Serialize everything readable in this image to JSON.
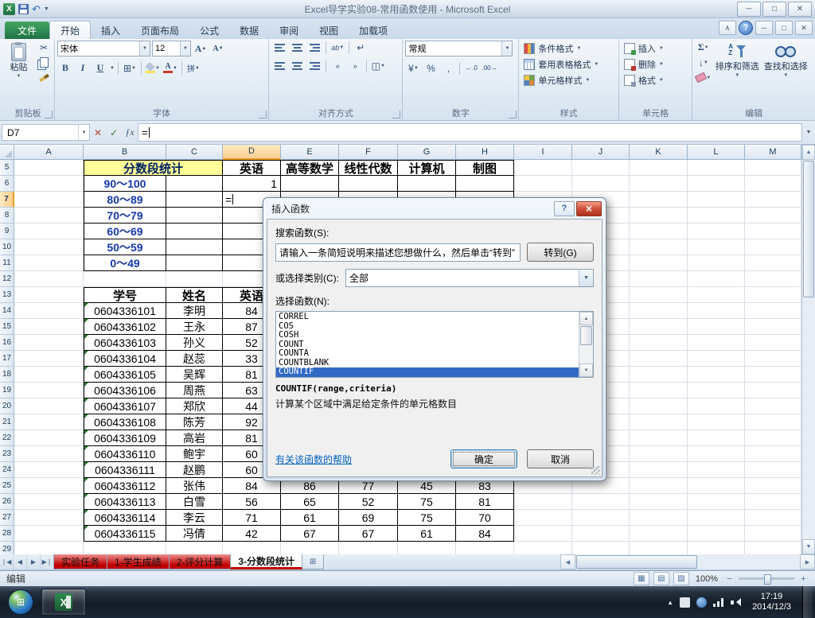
{
  "window": {
    "title": "Excel导学实验08-常用函数使用  -  Microsoft Excel"
  },
  "ribbon": {
    "file_tab": "文件",
    "tabs": [
      "开始",
      "插入",
      "页面布局",
      "公式",
      "数据",
      "审阅",
      "视图",
      "加载项"
    ],
    "active_tab": "开始",
    "groups": {
      "clipboard": {
        "label": "剪贴板",
        "paste": "粘贴"
      },
      "font": {
        "label": "字体",
        "font_name": "宋体",
        "font_size": "12"
      },
      "alignment": {
        "label": "对齐方式"
      },
      "number": {
        "label": "数字",
        "format": "常规"
      },
      "styles": {
        "label": "样式",
        "items": [
          "条件格式",
          "套用表格格式",
          "单元格样式"
        ]
      },
      "cells": {
        "label": "单元格",
        "items": [
          "插入",
          "删除",
          "格式"
        ]
      },
      "editing": {
        "label": "编辑",
        "sort": "排序和筛选",
        "find": "查找和选择"
      }
    }
  },
  "formula_bar": {
    "name_box": "D7",
    "formula": "="
  },
  "grid": {
    "columns": [
      "A",
      "B",
      "C",
      "D",
      "E",
      "F",
      "G",
      "H",
      "I",
      "J",
      "K",
      "L",
      "M"
    ],
    "selected_column": "D",
    "selected_row": 7,
    "bordered_ranges": [
      {
        "rows": [
          5,
          11
        ],
        "cols": [
          "B",
          "H"
        ]
      },
      {
        "rows": [
          13,
          28
        ],
        "cols": [
          "B",
          "H"
        ]
      }
    ],
    "rows": [
      {
        "n": 5,
        "cells": [
          [
            "B",
            "分数段统计",
            "ttl",
            2
          ],
          [
            "D",
            "英语",
            "hdr"
          ],
          [
            "E",
            "高等数学",
            "hdr"
          ],
          [
            "F",
            "线性代数",
            "hdr"
          ],
          [
            "G",
            "计算机",
            "hdr"
          ],
          [
            "H",
            "制图",
            "hdr"
          ]
        ]
      },
      {
        "n": 6,
        "cells": [
          [
            "B",
            "90～100",
            "rng"
          ],
          [
            "D",
            "1",
            "numr"
          ]
        ]
      },
      {
        "n": 7,
        "cells": [
          [
            "B",
            "80～89",
            "rng"
          ],
          [
            "D",
            "=",
            "edit"
          ]
        ]
      },
      {
        "n": 8,
        "cells": [
          [
            "B",
            "70～79",
            "rng"
          ]
        ]
      },
      {
        "n": 9,
        "cells": [
          [
            "B",
            "60～69",
            "rng"
          ]
        ]
      },
      {
        "n": 10,
        "cells": [
          [
            "B",
            "50～59",
            "rng"
          ]
        ]
      },
      {
        "n": 11,
        "cells": [
          [
            "B",
            "0～49",
            "rng"
          ]
        ]
      },
      {
        "n": 12,
        "cells": []
      },
      {
        "n": 13,
        "cells": [
          [
            "B",
            "学号",
            "hdr"
          ],
          [
            "C",
            "姓名",
            "hdr"
          ],
          [
            "D",
            "英语",
            "hdr"
          ]
        ]
      },
      {
        "n": 14,
        "cells": [
          [
            "B",
            "0604336101",
            "id"
          ],
          [
            "C",
            "李明",
            "nm"
          ],
          [
            "D",
            "84",
            "sc"
          ]
        ]
      },
      {
        "n": 15,
        "cells": [
          [
            "B",
            "0604336102",
            "id"
          ],
          [
            "C",
            "王永",
            "nm"
          ],
          [
            "D",
            "87",
            "sc"
          ]
        ]
      },
      {
        "n": 16,
        "cells": [
          [
            "B",
            "0604336103",
            "id"
          ],
          [
            "C",
            "孙义",
            "nm"
          ],
          [
            "D",
            "52",
            "sc"
          ]
        ]
      },
      {
        "n": 17,
        "cells": [
          [
            "B",
            "0604336104",
            "id"
          ],
          [
            "C",
            "赵蕊",
            "nm"
          ],
          [
            "D",
            "33",
            "sc"
          ]
        ]
      },
      {
        "n": 18,
        "cells": [
          [
            "B",
            "0604336105",
            "id"
          ],
          [
            "C",
            "吴辉",
            "nm"
          ],
          [
            "D",
            "81",
            "sc"
          ]
        ]
      },
      {
        "n": 19,
        "cells": [
          [
            "B",
            "0604336106",
            "id"
          ],
          [
            "C",
            "周燕",
            "nm"
          ],
          [
            "D",
            "63",
            "sc"
          ]
        ]
      },
      {
        "n": 20,
        "cells": [
          [
            "B",
            "0604336107",
            "id"
          ],
          [
            "C",
            "郑欣",
            "nm"
          ],
          [
            "D",
            "44",
            "sc"
          ]
        ]
      },
      {
        "n": 21,
        "cells": [
          [
            "B",
            "0604336108",
            "id"
          ],
          [
            "C",
            "陈芳",
            "nm"
          ],
          [
            "D",
            "92",
            "sc"
          ]
        ]
      },
      {
        "n": 22,
        "cells": [
          [
            "B",
            "0604336109",
            "id"
          ],
          [
            "C",
            "高岩",
            "nm"
          ],
          [
            "D",
            "81",
            "sc"
          ]
        ]
      },
      {
        "n": 23,
        "cells": [
          [
            "B",
            "0604336110",
            "id"
          ],
          [
            "C",
            "鲍宇",
            "nm"
          ],
          [
            "D",
            "60",
            "sc"
          ]
        ]
      },
      {
        "n": 24,
        "cells": [
          [
            "B",
            "0604336111",
            "id"
          ],
          [
            "C",
            "赵鹏",
            "nm"
          ],
          [
            "D",
            "60",
            "sc"
          ]
        ]
      },
      {
        "n": 25,
        "cells": [
          [
            "B",
            "0604336112",
            "id"
          ],
          [
            "C",
            "张伟",
            "nm"
          ],
          [
            "D",
            "84",
            "sc"
          ],
          [
            "E",
            "86",
            "sc"
          ],
          [
            "F",
            "77",
            "sc"
          ],
          [
            "G",
            "45",
            "sc"
          ],
          [
            "H",
            "83",
            "sc"
          ]
        ]
      },
      {
        "n": 26,
        "cells": [
          [
            "B",
            "0604336113",
            "id"
          ],
          [
            "C",
            "白雪",
            "nm"
          ],
          [
            "D",
            "56",
            "sc"
          ],
          [
            "E",
            "65",
            "sc"
          ],
          [
            "F",
            "52",
            "sc"
          ],
          [
            "G",
            "75",
            "sc"
          ],
          [
            "H",
            "81",
            "sc"
          ]
        ]
      },
      {
        "n": 27,
        "cells": [
          [
            "B",
            "0604336114",
            "id"
          ],
          [
            "C",
            "李云",
            "nm"
          ],
          [
            "D",
            "71",
            "sc"
          ],
          [
            "E",
            "61",
            "sc"
          ],
          [
            "F",
            "69",
            "sc"
          ],
          [
            "G",
            "75",
            "sc"
          ],
          [
            "H",
            "70",
            "sc"
          ]
        ]
      },
      {
        "n": 28,
        "cells": [
          [
            "B",
            "0604336115",
            "id"
          ],
          [
            "C",
            "冯倩",
            "nm"
          ],
          [
            "D",
            "42",
            "sc"
          ],
          [
            "E",
            "67",
            "sc"
          ],
          [
            "F",
            "67",
            "sc"
          ],
          [
            "G",
            "61",
            "sc"
          ],
          [
            "H",
            "84",
            "sc"
          ]
        ]
      },
      {
        "n": 29,
        "cells": []
      }
    ]
  },
  "dialog": {
    "title": "插入函数",
    "search_label": "搜索函数(S):",
    "search_text": "请输入一条简短说明来描述您想做什么，然后单击“转到”",
    "go_button": "转到(G)",
    "category_label": "或选择类别(C):",
    "category_value": "全部",
    "select_label": "选择函数(N):",
    "functions": [
      "CORREL",
      "COS",
      "COSH",
      "COUNT",
      "COUNTA",
      "COUNTBLANK",
      "COUNTIF"
    ],
    "selected_function": "COUNTIF",
    "signature": "COUNTIF(range,criteria)",
    "description": "计算某个区域中满足给定条件的单元格数目",
    "help_link": "有关该函数的帮助",
    "ok_button": "确定",
    "cancel_button": "取消"
  },
  "sheet_tabs": [
    {
      "label": "实验任务",
      "color": "#c00000"
    },
    {
      "label": "1-学生成绩",
      "color": "#c00000"
    },
    {
      "label": "2-评分计算",
      "color": "#c00000"
    },
    {
      "label": "3-分数段统计",
      "color": "#c00000",
      "active": true
    }
  ],
  "status_bar": {
    "mode": "编辑",
    "zoom": "100%"
  },
  "taskbar": {
    "time": "17:19",
    "date": "2014/12/3"
  }
}
